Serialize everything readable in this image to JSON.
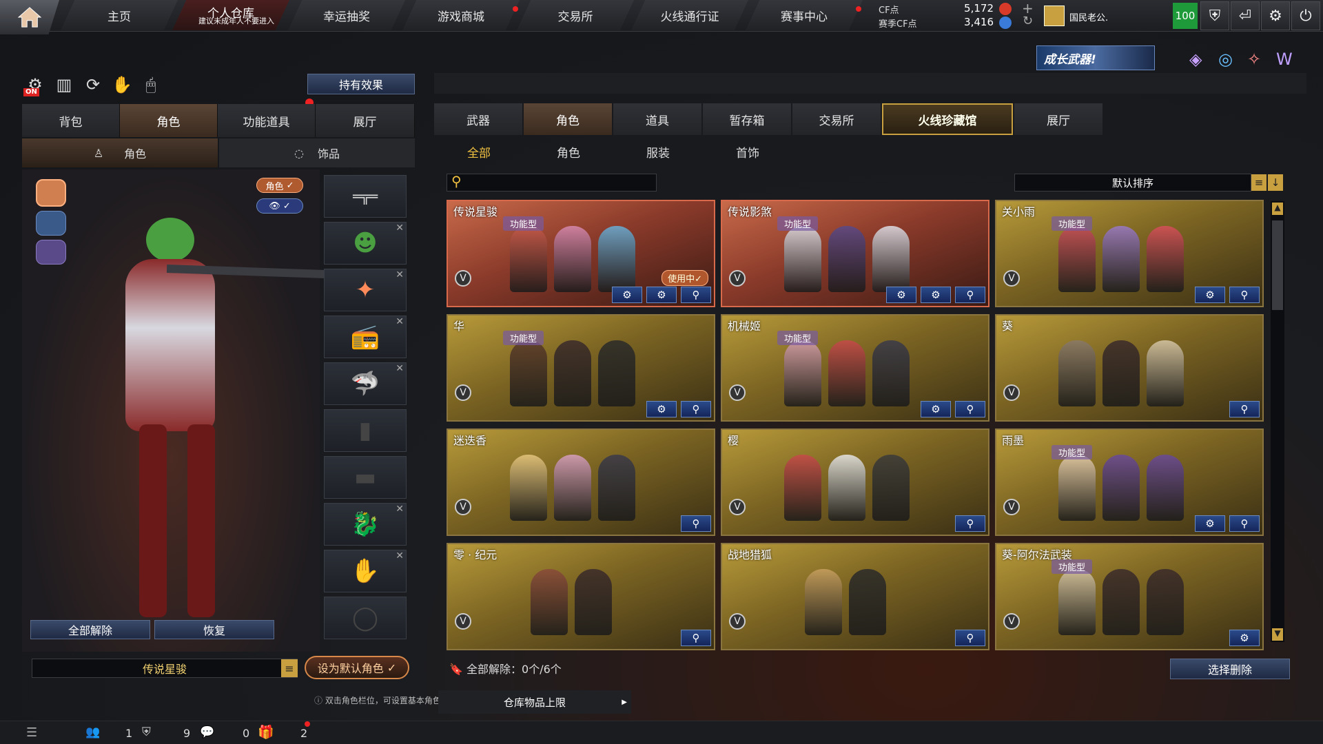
{
  "nav": {
    "home": "home",
    "tabs": [
      "主页",
      "个人仓库",
      "幸运抽奖",
      "游戏商城",
      "交易所",
      "火线通行证",
      "赛事中心"
    ],
    "warehouse_notice": "建议未成年人不要进入"
  },
  "currency": {
    "cf_label": "CF点",
    "cf_value": "5,172",
    "season_label": "赛季CF点",
    "season_value": "3,416"
  },
  "user": {
    "name": "国民老公.",
    "level": "100"
  },
  "banner": "成长武器!",
  "left": {
    "on_label": "ON",
    "effect_button": "持有效果",
    "tabs": [
      "背包",
      "角色",
      "功能道具",
      "展厅"
    ],
    "subtabs": [
      "角色",
      "饰品"
    ],
    "char_toggle": "角色",
    "unequip_all": "全部解除",
    "restore": "恢复",
    "current_role": "传说星骏",
    "set_default": "设为默认角色"
  },
  "right": {
    "tabs": [
      "武器",
      "角色",
      "道具",
      "暂存箱",
      "交易所",
      "火线珍藏馆",
      "展厅"
    ],
    "categories": [
      "全部",
      "角色",
      "服装",
      "首饰"
    ],
    "sort_label": "默认排序",
    "search_placeholder": "",
    "cards": [
      {
        "name": "传说星骏",
        "type": "功能型",
        "in_use": "使用中✓"
      },
      {
        "name": "传说影煞",
        "type": "功能型"
      },
      {
        "name": "关小雨",
        "type": "功能型"
      },
      {
        "name": "华",
        "type": "功能型"
      },
      {
        "name": "机械姬",
        "type": "功能型"
      },
      {
        "name": "葵",
        "type": ""
      },
      {
        "name": "迷迭香",
        "type": ""
      },
      {
        "name": "樱",
        "type": ""
      },
      {
        "name": "雨墨",
        "type": "功能型"
      },
      {
        "name": "零 · 纪元",
        "type": ""
      },
      {
        "name": "战地猎狐",
        "type": ""
      },
      {
        "name": "葵-阿尔法武装",
        "type": "功能型"
      }
    ],
    "unequip_status": "全部解除：0个/6个",
    "select_delete": "选择删除"
  },
  "footer": {
    "tip": "双击角色栏位，可设置基本角色。",
    "capacity": "仓库物品上限",
    "counts": [
      "1",
      "9",
      "0",
      "2"
    ]
  },
  "colors": {
    "accent_gold": "#c9a040",
    "red_card": "#d8694a",
    "blue_button": "#2a4a8a"
  }
}
